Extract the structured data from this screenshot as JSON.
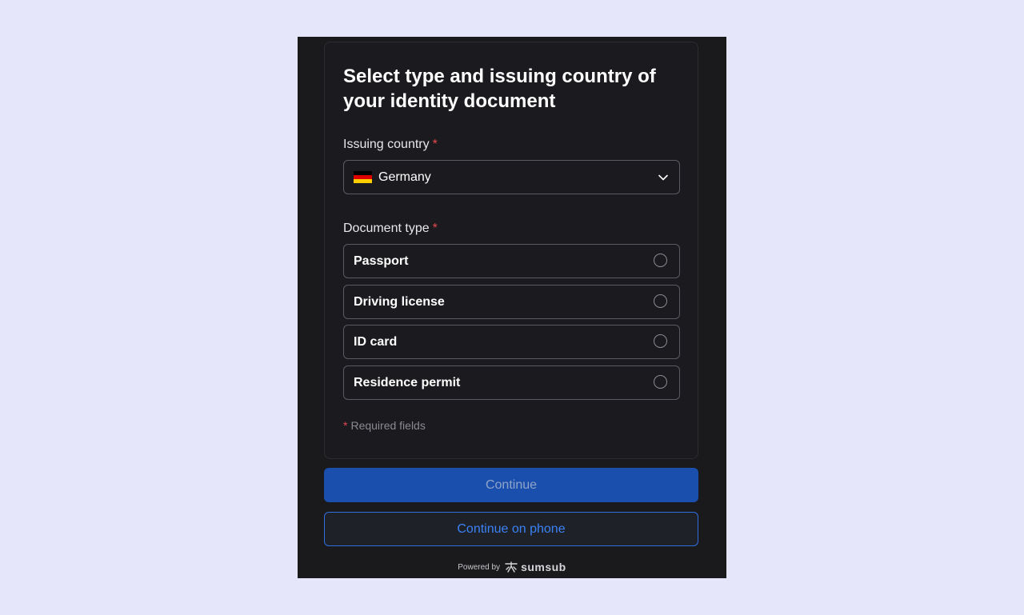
{
  "form": {
    "title": "Select type and issuing country of your identity document",
    "country_label": "Issuing country",
    "required_mark": "*",
    "country_value": "Germany",
    "country_flag_colors": [
      "#000000",
      "#dd0000",
      "#ffce00"
    ],
    "doc_type_label": "Document type",
    "doc_types": [
      {
        "label": "Passport",
        "selected": false
      },
      {
        "label": "Driving license",
        "selected": false
      },
      {
        "label": "ID card",
        "selected": false
      },
      {
        "label": "Residence permit",
        "selected": false
      }
    ],
    "required_note": "Required fields"
  },
  "actions": {
    "continue_label": "Continue",
    "continue_phone_label": "Continue on phone"
  },
  "footer": {
    "powered_by": "Powered by",
    "brand": "sumsub"
  },
  "colors": {
    "background": "#e6e6fa",
    "panel": "#1a1a1d",
    "primary": "#1b4fae",
    "accent": "#3b82f6",
    "required": "#e5484d"
  },
  "icons": [
    "germany-flag-icon",
    "chevron-down-icon",
    "radio-icon",
    "sumsub-logo-icon"
  ]
}
